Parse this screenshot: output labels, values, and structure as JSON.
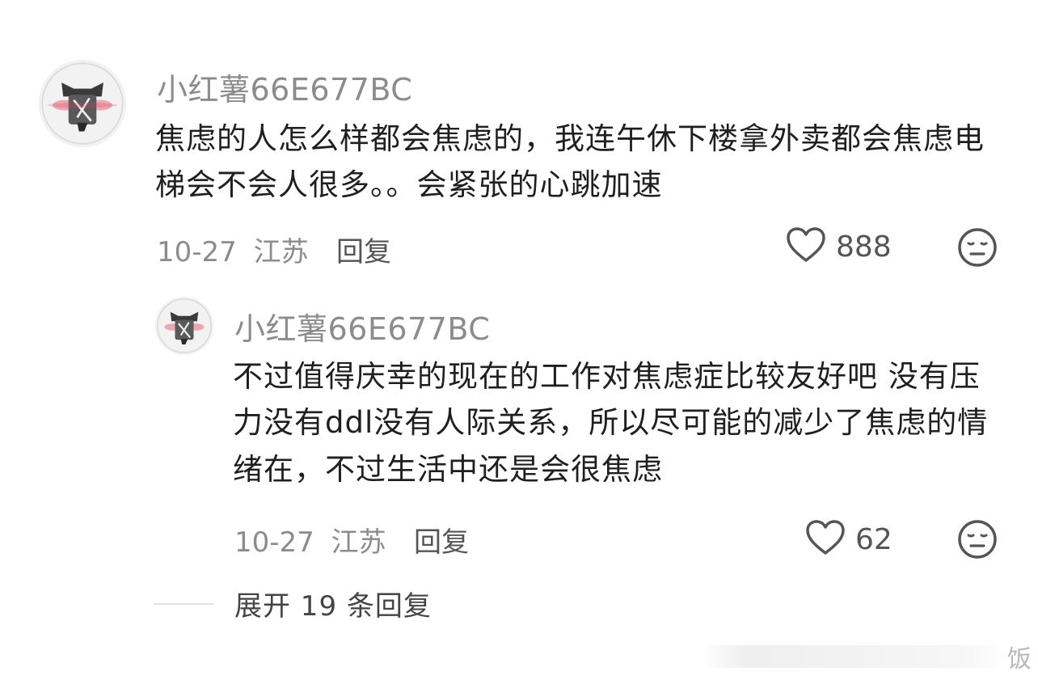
{
  "colors": {
    "meta_gray": "#8c8c8c",
    "content": "#1f1f1f",
    "icon": "#555555"
  },
  "comments": [
    {
      "username": "小红薯66E677BC",
      "content": "焦虑的人怎么样都会焦虑的，我连午休下楼拿外卖都会焦虑电梯会不会人很多。。会紧张的心跳加速",
      "date": "10-27",
      "location": "江苏",
      "reply_label": "回复",
      "like_count": "888",
      "like_icon": "heart-outline-icon",
      "dislike_icon": "meh-face-icon"
    },
    {
      "username": "小红薯66E677BC",
      "content": "不过值得庆幸的现在的工作对焦虑症比较友好吧 没有压力没有ddl没有人际关系，所以尽可能的减少了焦虑的情绪在，不过生活中还是会很焦虑",
      "date": "10-27",
      "location": "江苏",
      "reply_label": "回复",
      "like_count": "62",
      "like_icon": "heart-outline-icon",
      "dislike_icon": "meh-face-icon"
    }
  ],
  "expand_replies": {
    "label": "展开 19 条回复"
  },
  "watermark": {
    "text": "饭"
  }
}
